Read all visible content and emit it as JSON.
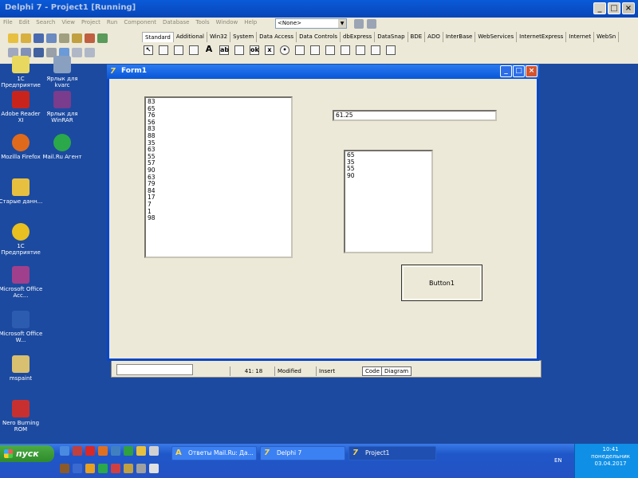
{
  "ide": {
    "title": "Delphi 7 - Project1 [Running]",
    "menu": [
      "File",
      "Edit",
      "Search",
      "View",
      "Project",
      "Run",
      "Component",
      "Database",
      "Tools",
      "Window",
      "Help"
    ],
    "combo_value": "<None>",
    "palette_tabs": [
      "Standard",
      "Additional",
      "Win32",
      "System",
      "Data Access",
      "Data Controls",
      "dbExpress",
      "DataSnap",
      "BDE",
      "ADO",
      "InterBase",
      "WebServices",
      "InternetExpress",
      "Internet",
      "WebSn"
    ],
    "palette_active": "Standard"
  },
  "desktop": {
    "icons": [
      {
        "label": "1С Предприятие",
        "color": "#e8d860"
      },
      {
        "label": "Ярлык для kvarc",
        "color": "#8aa0c0"
      },
      {
        "label": "Adobe Reader XI",
        "color": "#c8241c"
      },
      {
        "label": "Ярлык для WinRAR",
        "color": "#7a3c8c"
      },
      {
        "label": "Mozilla Firefox",
        "color": "#e06a1c"
      },
      {
        "label": "Mail.Ru Агент",
        "color": "#2aa84a"
      },
      {
        "label": "Старые данн...",
        "color": "#e8c040"
      },
      {
        "label": "1С Предприятие",
        "color": "#e8c020"
      },
      {
        "label": "Microsoft Office Acc...",
        "color": "#a0408c"
      },
      {
        "label": "Microsoft Office W...",
        "color": "#2c5cb0"
      },
      {
        "label": "mspaint",
        "color": "#d8c070"
      },
      {
        "label": "Nero Burning ROM",
        "color": "#c83030"
      }
    ]
  },
  "form": {
    "title": "Form1",
    "listbox1_items": [
      "83",
      "65",
      "76",
      "56",
      "83",
      "88",
      "35",
      "63",
      "55",
      "57",
      "90",
      "63",
      "79",
      "84",
      "17",
      "7",
      "1",
      "98"
    ],
    "edit1_value": "61.25",
    "listbox2_items": [
      "65",
      "35",
      "55",
      "90"
    ],
    "button1_label": "Button1"
  },
  "editor_status": {
    "position": "41: 18",
    "modified": "Modified",
    "mode": "Insert",
    "tab_code": "Code",
    "tab_diagram": "Diagram"
  },
  "taskbar": {
    "start_label": "пуск",
    "tasks": [
      {
        "label": "Ответы Mail.Ru: Да...",
        "active": false
      },
      {
        "label": "Delphi 7",
        "active": false
      },
      {
        "label": "Project1",
        "active": true
      }
    ],
    "lang": "EN",
    "time": "10:41",
    "day": "понедельник",
    "date": "03.04.2017"
  }
}
